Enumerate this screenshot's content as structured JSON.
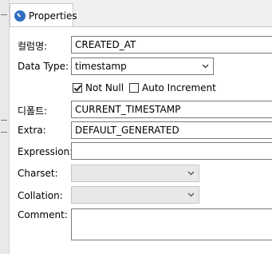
{
  "tab": {
    "label": "Properties",
    "icon": "properties-icon"
  },
  "form": {
    "column_name": {
      "label": "컬럼명:",
      "value": "CREATED_AT"
    },
    "data_type": {
      "label": "Data Type:",
      "value": "timestamp"
    },
    "not_null": {
      "label": "Not Null",
      "checked": true
    },
    "auto_increment": {
      "label": "Auto Increment",
      "checked": false
    },
    "default": {
      "label": "디폴트:",
      "value": "CURRENT_TIMESTAMP"
    },
    "extra": {
      "label": "Extra:",
      "value": "DEFAULT_GENERATED"
    },
    "expression": {
      "label": "Expression:",
      "value": ""
    },
    "charset": {
      "label": "Charset:",
      "value": ""
    },
    "collation": {
      "label": "Collation:",
      "value": ""
    },
    "comment": {
      "label": "Comment:",
      "value": ""
    }
  }
}
